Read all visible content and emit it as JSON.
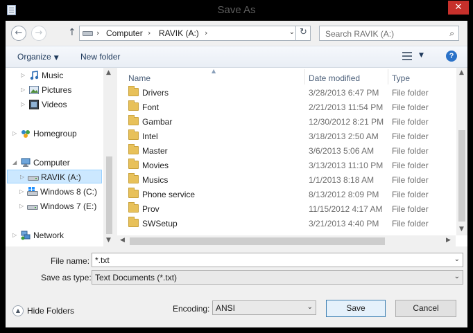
{
  "window": {
    "title": "Save As",
    "close_glyph": "✕"
  },
  "nav": {
    "back_glyph": "←",
    "forward_glyph": "→",
    "up_glyph": "↑",
    "refresh_glyph": "↻",
    "breadcrumb": [
      "Computer",
      "RAVIK (A:)"
    ],
    "separator": "›",
    "search_placeholder": "Search RAVIK (A:)"
  },
  "toolbar": {
    "organize": "Organize",
    "new_folder": "New folder",
    "help": "?"
  },
  "tree": [
    {
      "label": "Music",
      "icon": "music-icon"
    },
    {
      "label": "Pictures",
      "icon": "pictures-icon"
    },
    {
      "label": "Videos",
      "icon": "videos-icon"
    },
    {
      "label": "Homegroup",
      "icon": "homegroup-icon"
    },
    {
      "label": "Computer",
      "icon": "computer-icon"
    },
    {
      "label": "RAVIK (A:)",
      "icon": "drive-icon",
      "selected": true
    },
    {
      "label": "Windows 8 (C:)",
      "icon": "windows-drive-icon"
    },
    {
      "label": "Windows 7 (E:)",
      "icon": "drive-icon"
    },
    {
      "label": "Network",
      "icon": "network-icon"
    }
  ],
  "columns": {
    "name": "Name",
    "date": "Date modified",
    "type": "Type"
  },
  "files": [
    {
      "name": "Drivers",
      "date": "3/28/2013 6:47 PM",
      "type": "File folder"
    },
    {
      "name": "Font",
      "date": "2/21/2013 11:54 PM",
      "type": "File folder"
    },
    {
      "name": "Gambar",
      "date": "12/30/2012 8:21 PM",
      "type": "File folder"
    },
    {
      "name": "Intel",
      "date": "3/18/2013 2:50 AM",
      "type": "File folder"
    },
    {
      "name": "Master",
      "date": "3/6/2013 5:06 AM",
      "type": "File folder"
    },
    {
      "name": "Movies",
      "date": "3/13/2013 11:10 PM",
      "type": "File folder"
    },
    {
      "name": "Musics",
      "date": "1/1/2013 8:18 AM",
      "type": "File folder"
    },
    {
      "name": "Phone service",
      "date": "8/13/2012 8:09 PM",
      "type": "File folder"
    },
    {
      "name": "Prov",
      "date": "11/15/2012 4:17 AM",
      "type": "File folder"
    },
    {
      "name": "SWSetup",
      "date": "3/21/2013 4:40 PM",
      "type": "File folder"
    }
  ],
  "form": {
    "file_name_label": "File name:",
    "file_name_value": "*.txt",
    "save_type_label": "Save as type:",
    "save_type_value": "Text Documents (*.txt)",
    "encoding_label": "Encoding:",
    "encoding_value": "ANSI"
  },
  "buttons": {
    "hide_folders": "Hide Folders",
    "save": "Save",
    "cancel": "Cancel"
  },
  "colors": {
    "selection": "#cce8ff",
    "folder": "#e8c15a",
    "close": "#c7302b"
  }
}
